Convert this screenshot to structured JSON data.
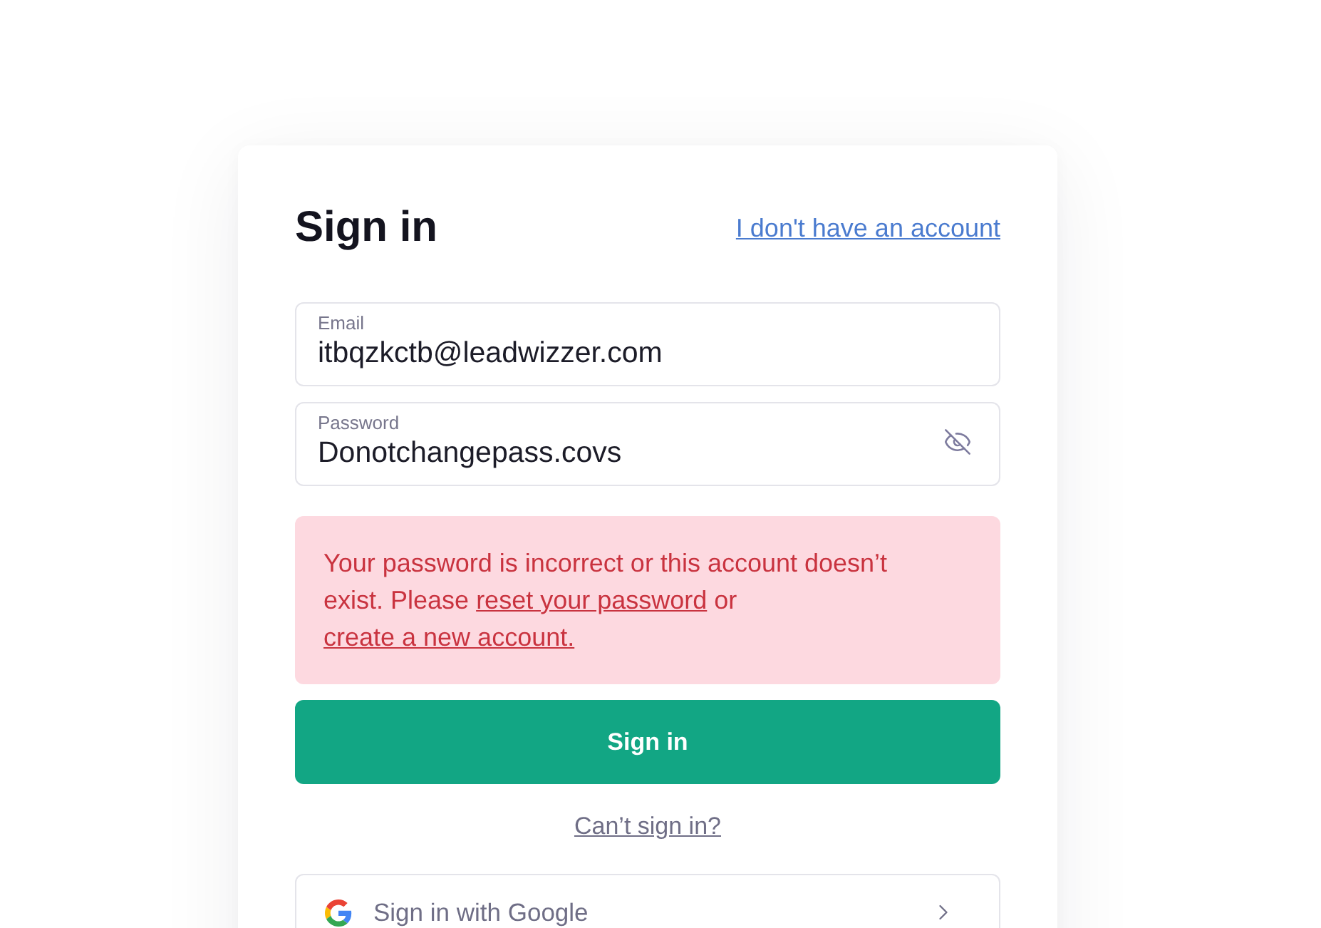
{
  "header": {
    "title": "Sign in",
    "link": "I don't have an account"
  },
  "fields": [
    {
      "kind": "text",
      "label": "Email",
      "value": "itbqzkctb@leadwizzer.com"
    },
    {
      "kind": "password",
      "label": "Password",
      "value": "Donotchangepass.covs"
    }
  ],
  "error": {
    "parts": [
      {
        "kind": "text",
        "text": "Your password is incorrect or this account doesn’t exist. Please "
      },
      {
        "kind": "link",
        "text": "reset your password"
      },
      {
        "kind": "text",
        "text": " or "
      },
      {
        "kind": "link",
        "text": "create a new account."
      }
    ]
  },
  "submit_button": "Sign in",
  "help_link": "Can’t sign in?",
  "providers": [
    {
      "kind": "google",
      "label": "Sign in with Google"
    }
  ]
}
